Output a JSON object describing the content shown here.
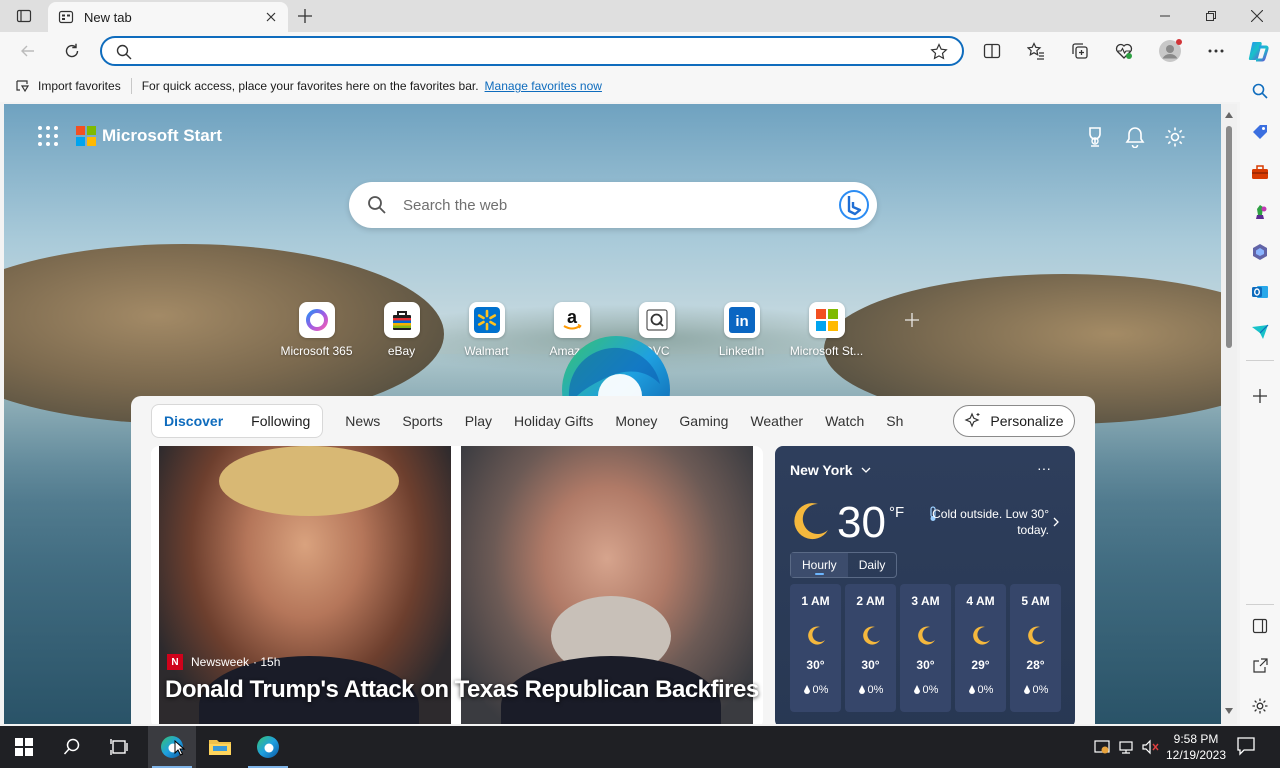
{
  "browser": {
    "tab_title": "New tab",
    "address_value": "",
    "favorites_bar": {
      "import_label": "Import favorites",
      "message": "For quick access, place your favorites here on the favorites bar.",
      "link": "Manage favorites now"
    }
  },
  "start": {
    "brand": "Microsoft Start",
    "search_placeholder": "Search the web",
    "quicklinks": [
      {
        "label": "Microsoft 365",
        "icon": "microsoft-365-icon"
      },
      {
        "label": "eBay",
        "icon": "ebay-icon"
      },
      {
        "label": "Walmart",
        "icon": "walmart-icon"
      },
      {
        "label": "Amazon",
        "icon": "amazon-icon"
      },
      {
        "label": "QVC",
        "icon": "qvc-icon"
      },
      {
        "label": "LinkedIn",
        "icon": "linkedin-icon"
      },
      {
        "label": "Microsoft St...",
        "icon": "microsoft-store-icon"
      }
    ]
  },
  "feed": {
    "tabs": [
      "Discover",
      "Following"
    ],
    "active_tab": "Discover",
    "categories": [
      "News",
      "Sports",
      "Play",
      "Holiday Gifts",
      "Money",
      "Gaming",
      "Weather",
      "Watch",
      "Sh"
    ],
    "personalize": "Personalize",
    "story": {
      "publisher": "Newsweek",
      "age": "· 15h",
      "headline": "Donald Trump's Attack on Texas Republican Backfires"
    }
  },
  "weather": {
    "location": "New York",
    "temp": "30",
    "unit": "°F",
    "alert": "Cold outside. Low 30° today.",
    "tabs": [
      "Hourly",
      "Daily"
    ],
    "active_tab": "Hourly",
    "hours": [
      {
        "time": "1 AM",
        "temp": "30°",
        "precip": "0%"
      },
      {
        "time": "2 AM",
        "temp": "30°",
        "precip": "0%"
      },
      {
        "time": "3 AM",
        "temp": "30°",
        "precip": "0%"
      },
      {
        "time": "4 AM",
        "temp": "29°",
        "precip": "0%"
      },
      {
        "time": "5 AM",
        "temp": "28°",
        "precip": "0%"
      }
    ]
  },
  "taskbar": {
    "time": "9:58 PM",
    "date": "12/19/2023"
  },
  "colors": {
    "accent": "#0f6cbd",
    "weather_bg": "#2e3e5c",
    "taskbar": "#1f2024"
  }
}
